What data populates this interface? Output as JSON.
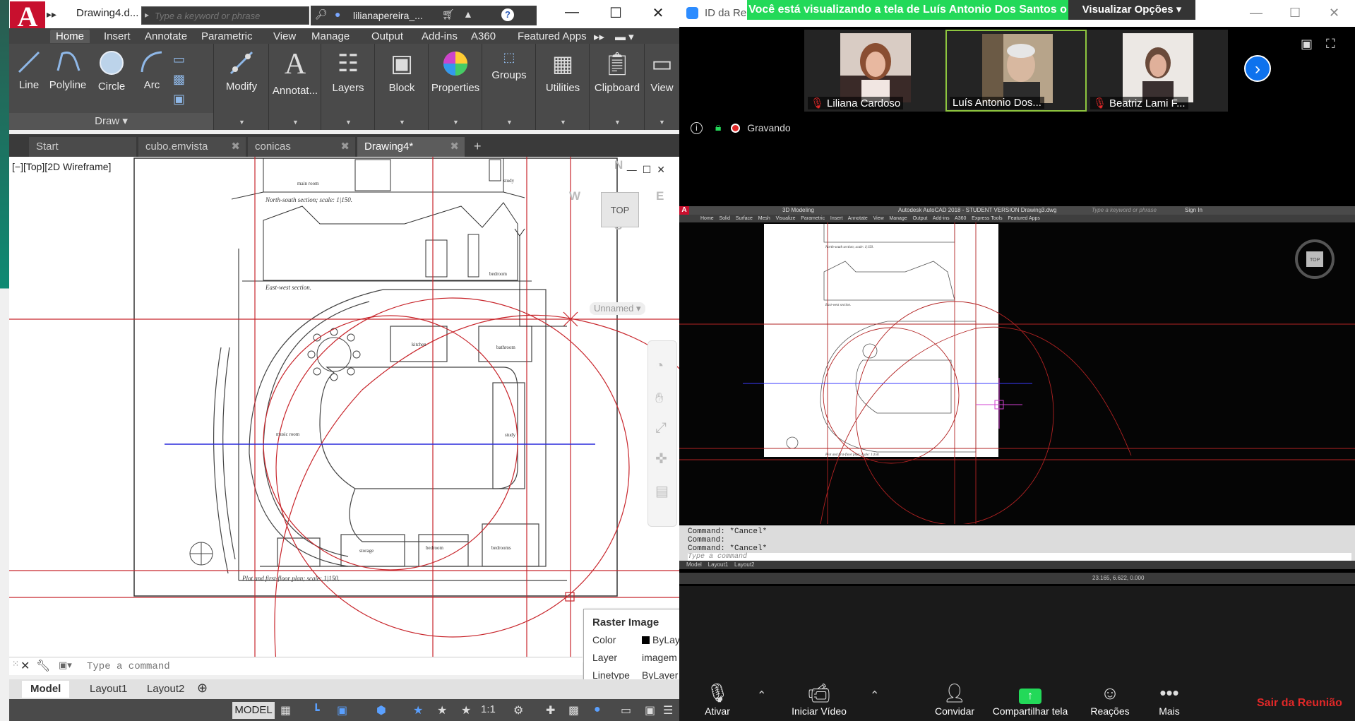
{
  "acad": {
    "app_logo": "A",
    "doc_title": "Drawing4.d...",
    "search_placeholder": "Type a keyword or phrase",
    "user_name": "lilianapereira_...",
    "ribbon_tabs": [
      "Home",
      "Insert",
      "Annotate",
      "Parametric",
      "View",
      "Manage",
      "Output",
      "Add-ins",
      "A360",
      "Featured Apps"
    ],
    "draw_tools": {
      "line": "Line",
      "polyline": "Polyline",
      "circle": "Circle",
      "arc": "Arc",
      "panel_label": "Draw"
    },
    "panels": {
      "modify": "Modify",
      "annotation": "Annotat...",
      "layers": "Layers",
      "block": "Block",
      "properties": "Properties",
      "groups": "Groups",
      "utilities": "Utilities",
      "clipboard": "Clipboard",
      "view": "View"
    },
    "doc_tabs": [
      "Start",
      "cubo.emvista",
      "conicas",
      "Drawing4*"
    ],
    "viewport_label": "[−][Top][2D Wireframe]",
    "viewcube": {
      "top": "TOP",
      "n": "N",
      "s": "S",
      "e": "E",
      "w": "W",
      "ucs": "Unnamed"
    },
    "plan_labels": {
      "north_south": "North-south section; scale: 1|150.",
      "east_west": "East-west section.",
      "plot": "Plot and first-floor plan; scale: 1|150.",
      "main_room": "main room",
      "study": "study",
      "bedroom": "bedroom",
      "kitchen": "kitchen",
      "bathroom": "bathroom",
      "music_room": "music room",
      "storage": "storage",
      "bedroom2": "bedroom",
      "bedrooms": "bedrooms",
      "study2": "study"
    },
    "tooltip": {
      "title": "Raster Image",
      "color_label": "Color",
      "color_value": "ByLayer",
      "layer_label": "Layer",
      "layer_value": "imagem",
      "linetype_label": "Linetype",
      "linetype_value": "ByLayer"
    },
    "command_placeholder": "Type a command",
    "layout_tabs": [
      "Model",
      "Layout1",
      "Layout2"
    ],
    "status": {
      "model": "MODEL",
      "scale": "1:1"
    },
    "colors": {
      "accent_red": "#c8102e",
      "ribbon": "#4a4a4a"
    }
  },
  "zoom": {
    "window_title": "ID da Re",
    "share_banner": "Você está visualizando a tela de Luís Antonio Dos Santos o",
    "view_options": "Visualizar Opções",
    "participants": [
      {
        "name": "Liliana Cardoso",
        "muted": true
      },
      {
        "name": "Luís Antonio Dos...",
        "muted": false
      },
      {
        "name": "Beatriz Lami F...",
        "muted": true
      }
    ],
    "recording": "Gravando",
    "shared_screen": {
      "title": "Autodesk AutoCAD 2018 - STUDENT VERSION    Drawing3.dwg",
      "workspace": "3D Modeling",
      "search": "Type a keyword or phrase",
      "sign_in": "Sign In",
      "tabs": "Home    Solid    Surface    Mesh    Visualize    Parametric    Insert    Annotate    View    Manage    Output    Add-ins    A360    Express Tools    Featured Apps",
      "command_lines": [
        "Command: *Cancel*",
        "Command:",
        "Command: *Cancel*"
      ],
      "command_placeholder": "Type a command",
      "layouts": "Model    Layout1    Layout2",
      "coords": "23.165, 6.622, 0.000",
      "plan_caption_top": "North-south section; scale: 1|150.",
      "plan_caption_mid": "East-west section.",
      "plan_caption_bottom": "Plot and first-floor plan; scale: 1|150.",
      "compass_top": "TOP"
    },
    "toolbar": {
      "mute": "Ativar",
      "video": "Iniciar Vídeo",
      "invite": "Convidar",
      "share": "Compartilhar tela",
      "reactions": "Reações",
      "more": "Mais",
      "leave": "Sair da Reunião"
    },
    "colors": {
      "banner": "#23d959",
      "leave": "#e02828",
      "active_border": "#8ec63f",
      "next": "#0e72ed"
    }
  }
}
